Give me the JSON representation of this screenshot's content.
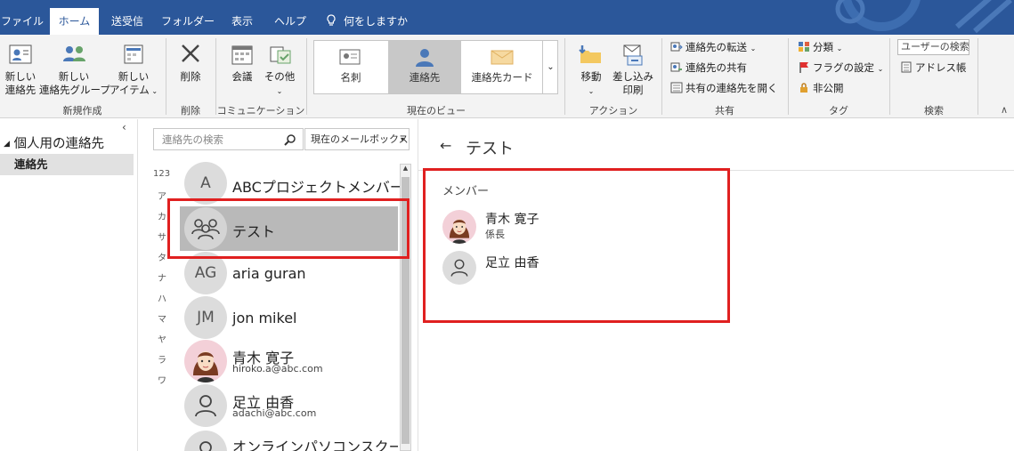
{
  "tabs": [
    "ファイル",
    "ホーム",
    "送受信",
    "フォルダー",
    "表示",
    "ヘルプ"
  ],
  "tell_me": "何をしますか",
  "ribbon": {
    "new_contact": "新しい\n連絡先",
    "new_group": "新しい\n連絡先グループ",
    "new_items": "新しい\nアイテム",
    "group_new": "新規作成",
    "delete": "削除",
    "group_delete": "削除",
    "meeting": "会議",
    "more": "その他",
    "group_comm": "コミュニケーション",
    "view_card": "名刺",
    "view_people": "連絡先",
    "view_contact_card": "連絡先カード",
    "group_view": "現在のビュー",
    "move": "移動",
    "mail_merge": "差し込み\n印刷",
    "group_action": "アクション",
    "forward_contact": "連絡先の転送",
    "share_contacts": "連絡先の共有",
    "open_shared": "共有の連絡先を開く",
    "group_share": "共有",
    "categorize": "分類",
    "follow_up": "フラグの設定",
    "private": "非公開",
    "group_tags": "タグ",
    "search_people": "ユーザーの検索",
    "address_book": "アドレス帳",
    "group_search": "検索"
  },
  "nav": {
    "folder_root": "個人用の連絡先",
    "folder_contacts": "連絡先"
  },
  "list": {
    "search_placeholder": "連絡先の検索",
    "scope": "現在のメールボックス",
    "index": [
      "123",
      "ア",
      "カ",
      "サ",
      "タ",
      "ナ",
      "ハ",
      "マ",
      "ヤ",
      "ラ",
      "ワ"
    ],
    "contacts": [
      {
        "initials": "A",
        "name": "ABCプロジェクトメンバー",
        "email": ""
      },
      {
        "initials": "",
        "name": "テスト",
        "email": ""
      },
      {
        "initials": "AG",
        "name": "aria guran",
        "email": ""
      },
      {
        "initials": "JM",
        "name": "jon mikel",
        "email": ""
      },
      {
        "initials": "",
        "name": "青木 寛子",
        "email": "hiroko.a@abc.com"
      },
      {
        "initials": "",
        "name": "足立 由香",
        "email": "adachi@abc.com"
      },
      {
        "initials": "",
        "name": "オンラインパソコンスクール…",
        "email": ""
      }
    ]
  },
  "detail": {
    "title": "テスト",
    "members_label": "メンバー",
    "members": [
      {
        "name": "青木 寛子",
        "title": "係長"
      },
      {
        "name": "足立 由香",
        "title": ""
      }
    ]
  }
}
